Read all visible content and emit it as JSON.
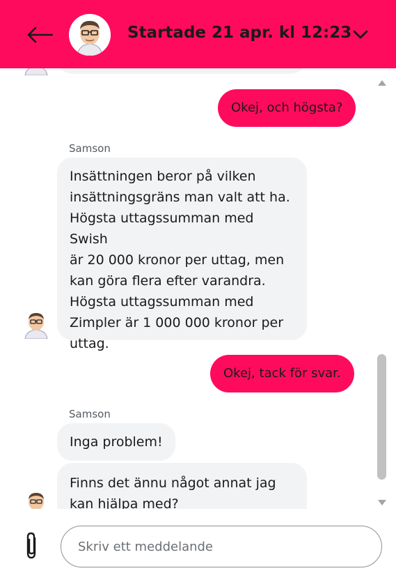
{
  "header": {
    "title": "Startade 21 apr. kl 12:23",
    "accent": "#ff0b5e",
    "back_icon": "arrow-left-icon",
    "expand_icon": "chevron-down-icon"
  },
  "messages": [
    {
      "from": "user",
      "text": "Okej, och högsta?"
    },
    {
      "from": "agent",
      "sender": "Samson",
      "lines": [
        "Insättningen beror på vilken",
        "insättningsgräns man valt att ha.",
        "Högsta uttagssumman med Swish",
        "är 20 000 kronor per uttag, men",
        "kan göra flera efter varandra.",
        "Högsta uttagssumman med",
        "Zimpler är 1 000 000 kronor per",
        "uttag."
      ]
    },
    {
      "from": "user",
      "text": "Okej, tack för svar."
    },
    {
      "from": "agent",
      "sender": "Samson",
      "text": "Inga problem!"
    },
    {
      "from": "agent",
      "lines": [
        "Finns det ännu något annat jag",
        "kan hjälpa med?"
      ]
    }
  ],
  "composer": {
    "placeholder": "Skriv ett meddelande",
    "attach_icon": "paperclip-icon"
  },
  "colors": {
    "agent_bubble": "#f2f3f5",
    "user_bubble": "#ff0b5e",
    "text": "#1a1a1a"
  }
}
